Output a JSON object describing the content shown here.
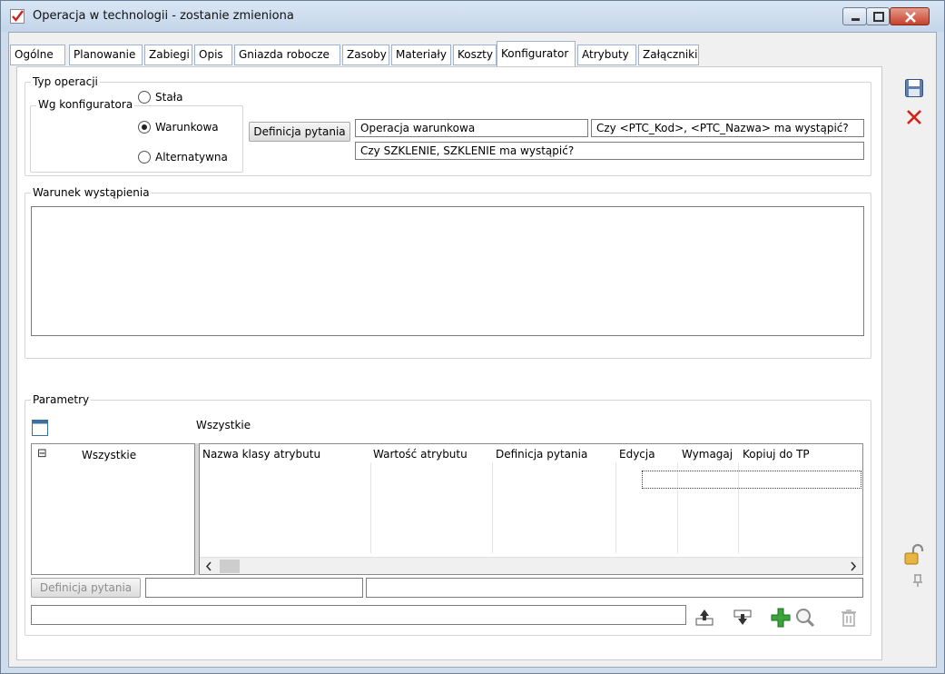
{
  "window": {
    "title": "Operacja w technologii - zostanie zmieniona"
  },
  "tabs": [
    {
      "label": "Ogólne"
    },
    {
      "label": "Planowanie"
    },
    {
      "label": "Zabiegi"
    },
    {
      "label": "Opis"
    },
    {
      "label": "Gniazda robocze"
    },
    {
      "label": "Zasoby"
    },
    {
      "label": "Materiały"
    },
    {
      "label": "Koszty"
    },
    {
      "label": "Konfigurator"
    },
    {
      "label": "Atrybuty"
    },
    {
      "label": "Załączniki"
    }
  ],
  "active_tab": "Konfigurator",
  "typ_operacji": {
    "legend": "Typ operacji",
    "wg_konfiguratora": "Wg konfiguratora",
    "options": {
      "stala": "Stała",
      "warunkowa": "Warunkowa",
      "alternatywna": "Alternatywna"
    },
    "selected": "Warunkowa",
    "definicja_button": "Definicja pytania",
    "field_type": "Operacja warunkowa",
    "field_question": "Czy <PTC_Kod>, <PTC_Nazwa> ma wystąpić?",
    "field_resolved": "Czy SZKLENIE, SZKLENIE ma wystąpić?"
  },
  "warunek": {
    "legend": "Warunek wystąpienia",
    "text": ""
  },
  "parametry": {
    "legend": "Parametry",
    "tree_root": "Wszystkie",
    "tree_expander": "⊟",
    "grid_caption": "Wszystkie",
    "columns": [
      "Nazwa klasy atrybutu",
      "Wartość atrybutu",
      "Definicja pytania",
      "Edycja",
      "Wymagaj",
      "Kopiuj do TP"
    ],
    "definicja_button": "Definicja pytania",
    "field1": "",
    "field2": "",
    "field3": ""
  },
  "side_icons": [
    "save-icon",
    "cancel-icon",
    "lock-icon",
    "pin-icon"
  ],
  "bottom_icons": [
    "export-icon",
    "import-icon",
    "add-icon",
    "search-icon",
    "delete-icon"
  ],
  "colors": {
    "titlebar": "#c9d9ec",
    "tab_border": "#9bb4d0",
    "close_red": "#c8412b",
    "add_green": "#3aa33a"
  }
}
